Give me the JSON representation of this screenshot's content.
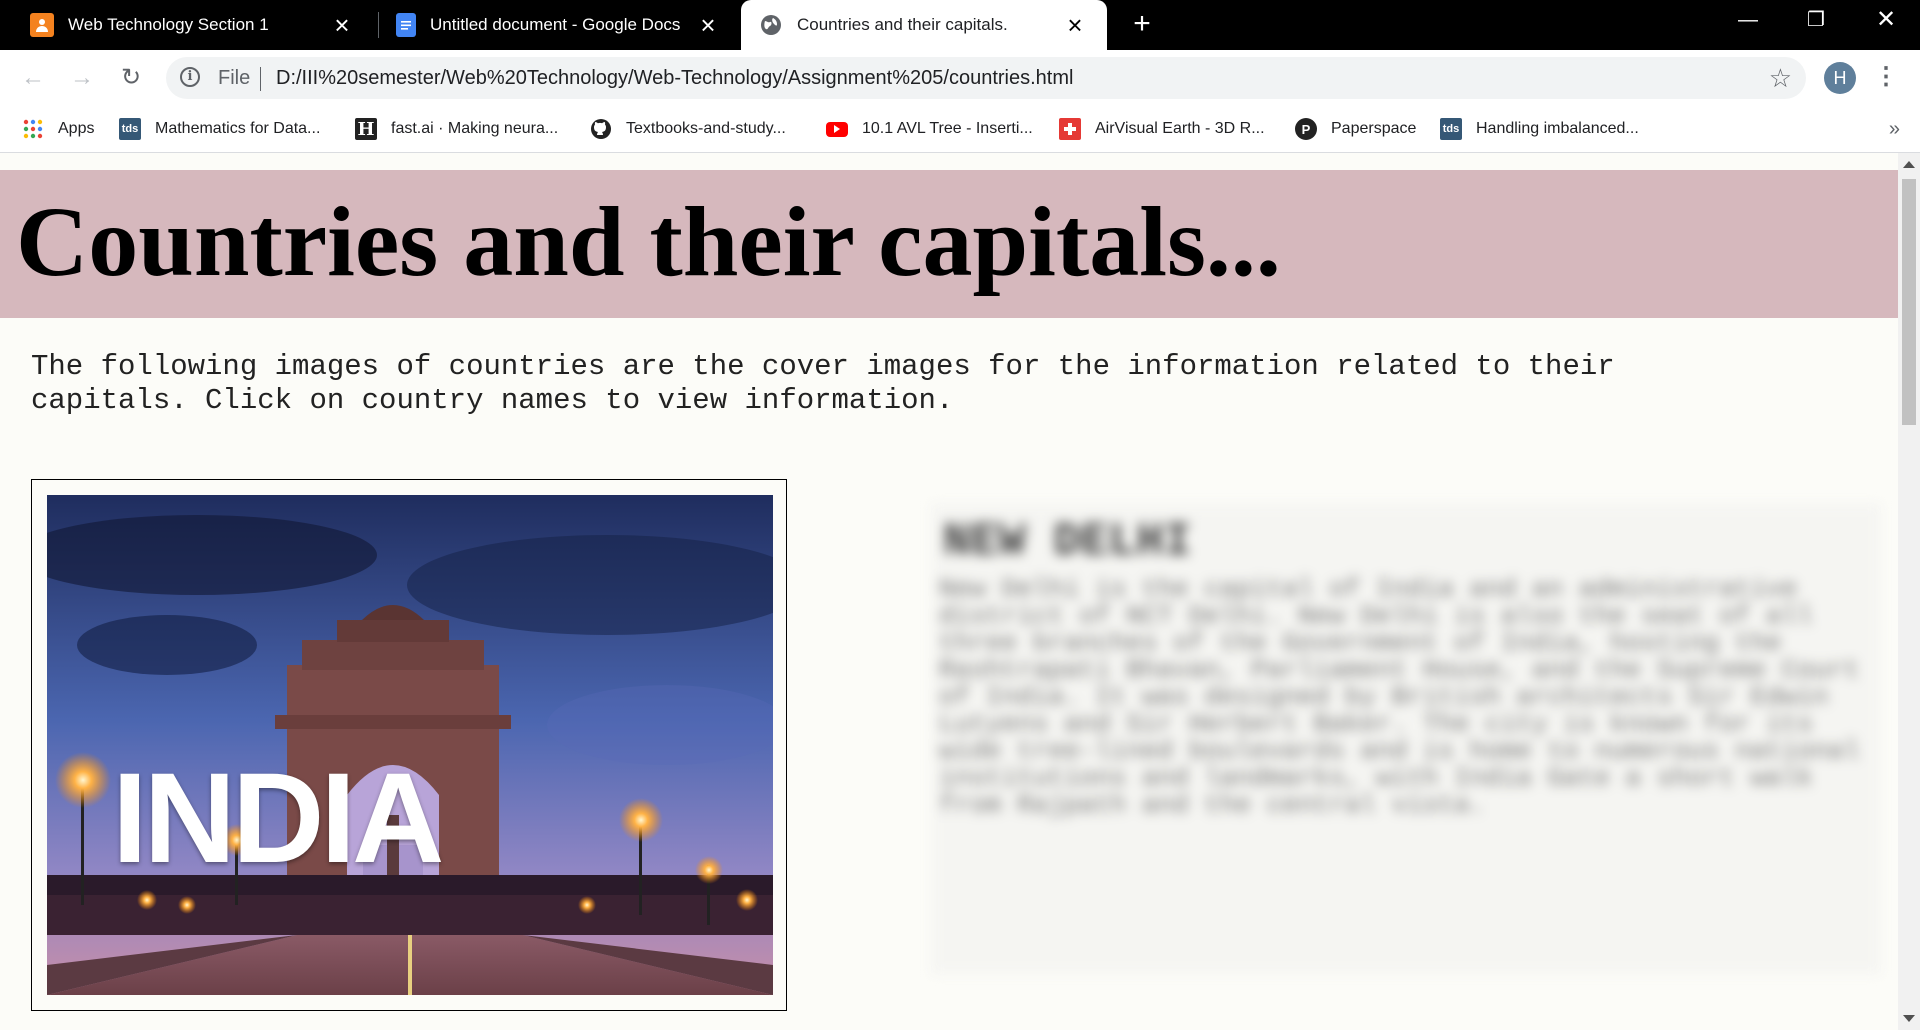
{
  "tabs": [
    {
      "title": "Web Technology Section 1",
      "icon": "person-orange-icon",
      "color": "#f4821f"
    },
    {
      "title": "Untitled document - Google Docs",
      "icon": "docs-icon",
      "color": "#4285f4"
    },
    {
      "title": "Countries and their capitals.",
      "icon": "globe-icon",
      "active": true
    }
  ],
  "toolbar": {
    "file_label": "File",
    "url": "D:/III%20semester/Web%20Technology/Web-Technology/Assignment%205/countries.html",
    "profile_initial": "H"
  },
  "bookmarks": [
    {
      "label": "Apps",
      "icon": "apps-grid-icon"
    },
    {
      "label": "Mathematics for Data...",
      "icon": "tds-icon",
      "icon_text": "tds"
    },
    {
      "label": "fast.ai · Making neura...",
      "icon": "fastai-icon",
      "icon_text": "H"
    },
    {
      "label": "Textbooks-and-study...",
      "icon": "github-icon"
    },
    {
      "label": "10.1 AVL Tree - Inserti...",
      "icon": "youtube-icon"
    },
    {
      "label": "AirVisual Earth - 3D R...",
      "icon": "airvisual-icon"
    },
    {
      "label": "Paperspace",
      "icon": "paperspace-icon",
      "icon_text": "P"
    },
    {
      "label": "Handling imbalanced...",
      "icon": "tds-icon",
      "icon_text": "tds"
    }
  ],
  "page": {
    "title": "Countries and their capitals...",
    "intro": "The following images of countries are the cover images for the information related to their capitals. Click on country names to view information.",
    "card": {
      "country": "INDIA"
    },
    "info": {
      "heading": "NEW DELHI",
      "text": "New Delhi is the capital of India and an administrative district of NCT Delhi. New Delhi is also the seat of all three branches of the Government of India, hosting the Rashtrapati Bhavan, Parliament House, and the Supreme Court of India. It was designed by British architects Sir Edwin Lutyens and Sir Herbert Baker. The city is known for its wide tree-lined boulevards and is home to numerous national institutions and landmarks, with India Gate a short walk from Rajpath and the central vista."
    }
  }
}
